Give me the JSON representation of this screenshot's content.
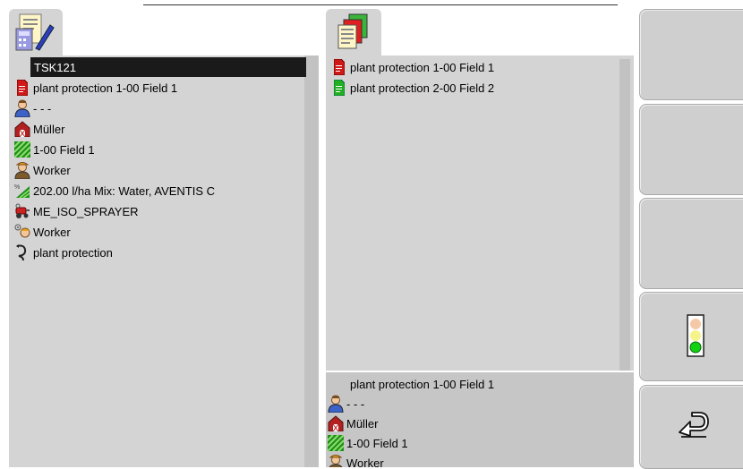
{
  "left_list": [
    {
      "label": "TSK121",
      "icon": "none",
      "selected": true
    },
    {
      "label": "plant protection 1-00 Field 1",
      "icon": "red-document-icon"
    },
    {
      "label": "- - -",
      "icon": "person-icon"
    },
    {
      "label": "Müller",
      "icon": "farm-building-icon"
    },
    {
      "label": "1-00 Field 1",
      "icon": "field-icon"
    },
    {
      "label": "Worker",
      "icon": "worker-icon"
    },
    {
      "label": "202.00 l/ha Mix: Water, AVENTIS C",
      "icon": "application-rate-icon"
    },
    {
      "label": "ME_ISO_SPRAYER",
      "icon": "sprayer-icon"
    },
    {
      "label": "Worker",
      "icon": "worker-face-icon"
    },
    {
      "label": "plant protection",
      "icon": "operation-hook-icon"
    }
  ],
  "task_list": [
    {
      "label": "plant protection 1-00 Field 1",
      "icon": "red-document-icon",
      "color": "#d01818"
    },
    {
      "label": "plant protection 2-00 Field 2",
      "icon": "green-document-icon",
      "color": "#22b022"
    }
  ],
  "detail": [
    {
      "label": "plant protection 1-00 Field 1",
      "icon": "none"
    },
    {
      "label": "- - -",
      "icon": "person-icon"
    },
    {
      "label": "Müller",
      "icon": "farm-building-icon"
    },
    {
      "label": "1-00 Field 1",
      "icon": "field-icon"
    },
    {
      "label": "Worker",
      "icon": "worker-icon"
    }
  ],
  "tabs": {
    "left": {
      "icon": "task-data-icon"
    },
    "right": {
      "icon": "task-list-icon"
    }
  },
  "softkeys": {
    "status": {
      "icon": "traffic-light-icon"
    },
    "back": {
      "icon": "return-arrow-icon"
    }
  }
}
